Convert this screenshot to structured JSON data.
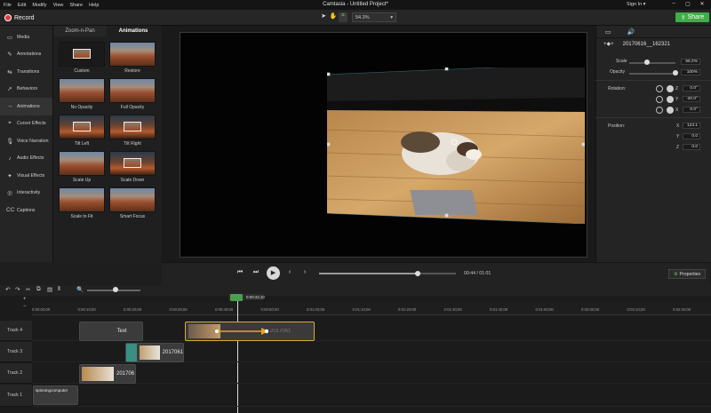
{
  "menubar": {
    "items": [
      "File",
      "Edit",
      "Modify",
      "View",
      "Share",
      "Help"
    ],
    "title": "Camtasia - Untitled Project*",
    "signin": "Sign In ▾",
    "window_controls": [
      "–",
      "▢",
      "✕"
    ]
  },
  "toolbar": {
    "record_label": "Record",
    "zoom_value": "54.3%",
    "share_label": "Share",
    "tool_icons": [
      "pointer-icon",
      "hand-icon",
      "crop-icon"
    ]
  },
  "tools_panel": {
    "items": [
      {
        "icon": "▭",
        "label": "Media"
      },
      {
        "icon": "✎",
        "label": "Annotations"
      },
      {
        "icon": "⇆",
        "label": "Transitions"
      },
      {
        "icon": "➚",
        "label": "Behaviors"
      },
      {
        "icon": "→",
        "label": "Animations",
        "active": true
      },
      {
        "icon": "⌖",
        "label": "Cursor Effects"
      },
      {
        "icon": "🎙",
        "label": "Voice Narration"
      },
      {
        "icon": "♪",
        "label": "Audio Effects"
      },
      {
        "icon": "✦",
        "label": "Visual Effects"
      },
      {
        "icon": "◎",
        "label": "Interactivity"
      },
      {
        "icon": "CC",
        "label": "Captions"
      }
    ]
  },
  "library": {
    "tabs": [
      "Zoom-n-Pan",
      "Animations"
    ],
    "active_tab": "Animations",
    "tiles": [
      {
        "label": "Custom",
        "style": "dark-inset"
      },
      {
        "label": "Restore",
        "style": "canyon"
      },
      {
        "label": "No Opacity",
        "style": "canyon"
      },
      {
        "label": "Full Opacity",
        "style": "canyon"
      },
      {
        "label": "Tilt Left",
        "style": "inset"
      },
      {
        "label": "Tilt Right",
        "style": "inset"
      },
      {
        "label": "Scale Up",
        "style": "canyon"
      },
      {
        "label": "Scale Down",
        "style": "inset"
      },
      {
        "label": "Scale to Fit",
        "style": "canyon"
      },
      {
        "label": "Smart Focus",
        "style": "canyon"
      }
    ]
  },
  "player": {
    "time": "00:44 / 01:01",
    "progress": 0.72,
    "properties_label": "Properties"
  },
  "properties": {
    "clip_name": "20170616__162321",
    "scale_label": "Scale",
    "scale_value": "66.2%",
    "scale_fraction": 0.38,
    "opacity_label": "Opacity",
    "opacity_value": "100%",
    "opacity_fraction": 1.0,
    "rotation_label": "Rotation:",
    "rotation": [
      {
        "axis": "Z",
        "value": "0.0°"
      },
      {
        "axis": "Y",
        "value": "-20.0°"
      },
      {
        "axis": "X",
        "value": "0.0°"
      }
    ],
    "position_label": "Position:",
    "position": [
      {
        "axis": "X",
        "value": "124.1"
      },
      {
        "axis": "Y",
        "value": "0.0"
      },
      {
        "axis": "Z",
        "value": "0.0"
      }
    ]
  },
  "timeline": {
    "playhead_time": "0:00:44;10",
    "ticks": [
      "0:00:00;00",
      "0:00:10;00",
      "0:00:20;00",
      "0:00:30;00",
      "0:00:40;00",
      "0:00:50;00",
      "0:01:00;00",
      "0:01:10;00",
      "0:01:20;00",
      "0:01:30;00",
      "0:01:40;00",
      "0:01:50;00",
      "0:02:00;00",
      "0:02:10;00",
      "0:02:20;00"
    ],
    "tracks": [
      {
        "label": "Track 4"
      },
      {
        "label": "Track 3"
      },
      {
        "label": "Track 2"
      },
      {
        "label": "Track 1"
      }
    ],
    "clips": {
      "track4_text": "Text",
      "track4_anim": "2017061",
      "track3": "2017061",
      "track2": "201706",
      "track1": "spinningcomputer"
    }
  },
  "colors": {
    "accent": "#3fae49",
    "record": "#e33b3b",
    "animation_arrow": "#e9a21f",
    "selection": "#d9a93a"
  }
}
